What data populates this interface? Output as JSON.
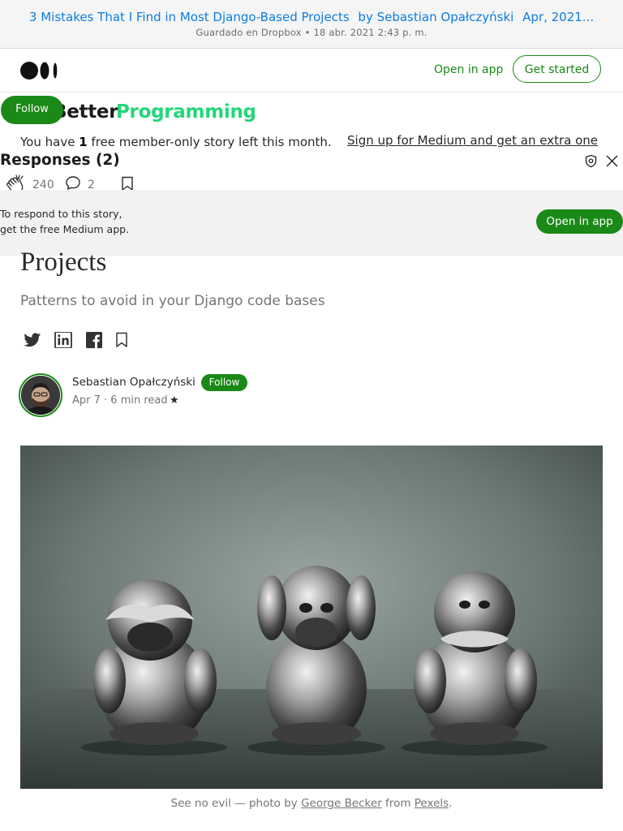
{
  "dropbox": {
    "title_part1": "3 Mistakes That I Find in Most Django-Based Projects",
    "title_part2": "by Sebastian Opałczyński",
    "title_part3": "Apr, 2021...",
    "saved_info": "Guardado en Dropbox • 18 abr. 2021 2:43 p. m."
  },
  "nav": {
    "logo_icon": "medium-logo-icon",
    "open_in_app": "Open in app",
    "get_started": "Get started"
  },
  "publication": {
    "name_part1": "Better",
    "name_part2": "Programming",
    "follow_label": "Follow",
    "brand_color": "#23d67b"
  },
  "paywall": {
    "prefix": "You have ",
    "count": "1",
    "suffix": " free member-only story left this month.",
    "signup_link": "Sign up for Medium and get an extra one"
  },
  "responses": {
    "title": "Responses (2)",
    "clap_count": "240",
    "comment_count": "2",
    "respond_line1": "To respond to this story,",
    "respond_line2": "get the free Medium app.",
    "open_in_app": "Open in app"
  },
  "article": {
    "title_visible": "Projects",
    "subtitle": "Patterns to avoid in your Django code bases",
    "share_icons": [
      "twitter-icon",
      "linkedin-icon",
      "facebook-icon",
      "bookmark-icon"
    ],
    "author": {
      "name": "Sebastian Opałczyński",
      "follow_label": "Follow",
      "meta": "Apr 7 · 6 min read",
      "star": "★"
    },
    "image_caption": {
      "text_before": "See no evil — photo by ",
      "author_link": "George Becker",
      "middle": " from ",
      "source_link": "Pexels",
      "end": "."
    }
  },
  "colors": {
    "accent_green": "#1a8917",
    "dropbox_link_blue": "#0d7de0"
  }
}
